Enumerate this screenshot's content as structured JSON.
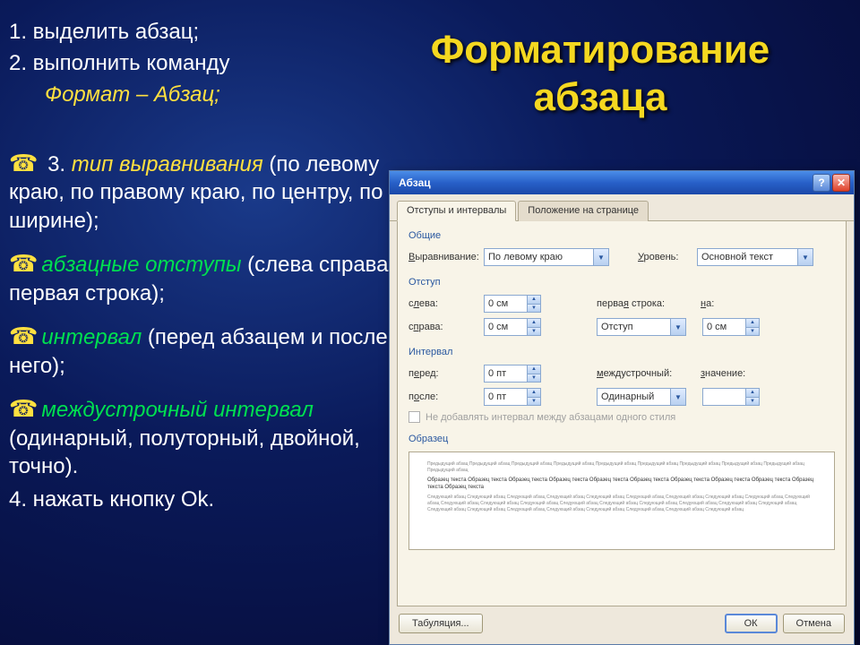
{
  "slide": {
    "title": "Форматирование абзаца",
    "step1": "1. выделить абзац;",
    "step2": "2. выполнить команду",
    "menu_path": "Формат – Абзац;",
    "overlap_line": "3. тип выравнивания (по Абзац",
    "b1_em": "тип выравнивания",
    "b1_rest": " (по левому краю, по правому краю, по центру, по ширине);",
    "b2_em": "абзацные отступы",
    "b2_rest": " (слева справа, первая строка);",
    "b3_em": "интервал",
    "b3_rest": " (перед абзацем и после него);",
    "b4_em": "междустрочный интервал",
    "b4_rest": "(одинарный, полуторный, двойной, точно).",
    "step4": "4. нажать кнопку Ok."
  },
  "dialog": {
    "title": "Абзац",
    "tabs": {
      "tab1": "Отступы и интервалы",
      "tab2": "Положение на странице"
    },
    "groups": {
      "general": "Общие",
      "indent": "Отступ",
      "spacing": "Интервал",
      "preview": "Образец"
    },
    "labels": {
      "alignment": "Выравнивание:",
      "level": "Уровень:",
      "left": "слева:",
      "right": "справа:",
      "first_line": "первая строка:",
      "by": "на:",
      "before": "перед:",
      "after": "после:",
      "line_spacing": "междустрочный:",
      "value": "значение:"
    },
    "values": {
      "alignment": "По левому краю",
      "level": "Основной текст",
      "left": "0 см",
      "right": "0 см",
      "first_line": "Отступ",
      "by": "0 см",
      "before": "0 пт",
      "after": "0 пт",
      "line_spacing": "Одинарный",
      "value": ""
    },
    "checkbox": "Не добавлять интервал между абзацами одного стиля",
    "preview_gray": "Предыдущий абзац Предыдущий абзац Предыдущий абзац Предыдущий абзац Предыдущий абзац Предыдущий абзац Предыдущий абзац Предыдущий абзац Предыдущий абзац Предыдущий абзац",
    "preview_main": "Образец текста Образец текста Образец текста Образец текста Образец текста Образец текста Образец текста Образец текста Образец текста Образец текста Образец текста",
    "preview_after": "Следующий абзац Следующий абзац Следующий абзац Следующий абзац Следующий абзац Следующий абзац Следующий абзац Следующий абзац Следующий абзац Следующий абзац Следующий абзац Следующий абзац Следующий абзац Следующий абзац Следующий абзац Следующий абзац Следующий абзац Следующий абзац Следующий абзац Следующий абзац Следующий абзац Следующий абзац Следующий абзац Следующий абзац Следующий абзац Следующий абзац Следующий абзац",
    "buttons": {
      "tabs": "Табуляция...",
      "ok": "ОК",
      "cancel": "Отмена"
    }
  }
}
